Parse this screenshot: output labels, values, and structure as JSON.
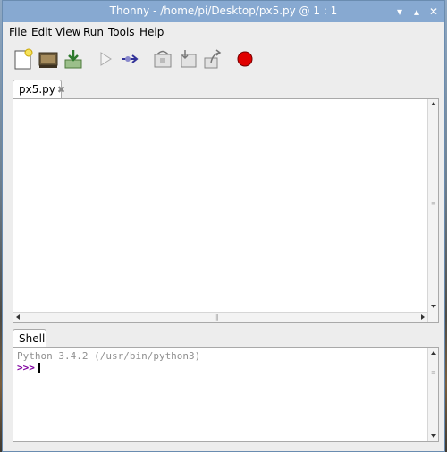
{
  "window": {
    "title": "Thonny  -  /home/pi/Desktop/px5.py  @  1 : 1"
  },
  "menu": [
    "File",
    "Edit",
    "View",
    "Run",
    "Tools",
    "Help"
  ],
  "toolbar": {
    "buttons": [
      {
        "name": "new-file",
        "icon": "new-file-icon"
      },
      {
        "name": "open-file",
        "icon": "open-folder-icon"
      },
      {
        "name": "save-file",
        "icon": "save-icon"
      },
      {
        "name": "run",
        "icon": "run-icon"
      },
      {
        "name": "debug",
        "icon": "debug-icon"
      },
      {
        "name": "step-over",
        "icon": "step-over-icon"
      },
      {
        "name": "step-into",
        "icon": "step-into-icon"
      },
      {
        "name": "step-out",
        "icon": "step-out-icon"
      },
      {
        "name": "stop",
        "icon": "stop-icon"
      }
    ],
    "colors": {
      "stop": "#e00000",
      "run": "#c8c8c8",
      "debug": "#333399"
    }
  },
  "editor": {
    "tab_label": "px5.py",
    "tab_close": "✖"
  },
  "shell": {
    "tab_label": "Shell",
    "banner": "Python 3.4.2 (/usr/bin/python3)",
    "prompt": ">>>"
  },
  "colors": {
    "titlebar": "#87a9d1",
    "prompt": "#8000a0",
    "banner": "#909090"
  }
}
